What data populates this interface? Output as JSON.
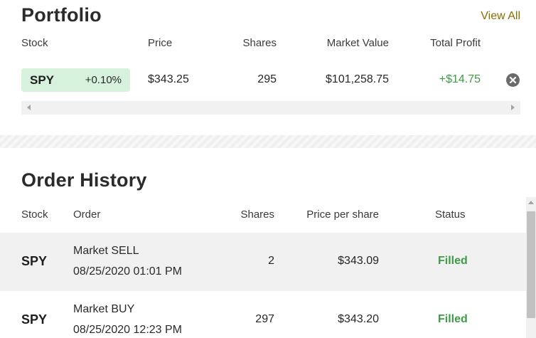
{
  "portfolio": {
    "title": "Portfolio",
    "view_all": "View All",
    "columns": [
      "Stock",
      "Price",
      "Shares",
      "Market Value",
      "Total Profit"
    ],
    "holding": {
      "symbol": "SPY",
      "change": "+0.10%",
      "price": "$343.25",
      "shares": "295",
      "market_value": "$101,258.75",
      "total_profit": "+$14.75"
    }
  },
  "orders": {
    "title": "Order History",
    "columns": [
      "Stock",
      "Order",
      "Shares",
      "Price per share",
      "Status"
    ],
    "rows": [
      {
        "symbol": "SPY",
        "order_type": "Market SELL",
        "datetime": "08/25/2020 01:01 PM",
        "shares": "2",
        "price": "$343.09",
        "status": "Filled"
      },
      {
        "symbol": "SPY",
        "order_type": "Market BUY",
        "datetime": "08/25/2020 12:23 PM",
        "shares": "297",
        "price": "$343.20",
        "status": "Filled"
      }
    ]
  },
  "colors": {
    "profit_green": "#3f9b45",
    "badge_green": "#d6f1dc",
    "link_gold": "#8a6d00"
  },
  "icons": [
    "close-circle-icon",
    "scroll-left-arrow",
    "scroll-right-arrow",
    "scroll-up-arrow"
  ]
}
